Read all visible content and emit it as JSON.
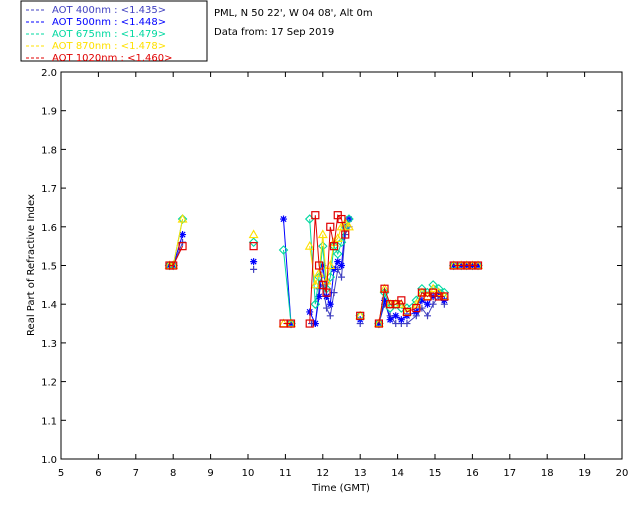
{
  "legend": [
    {
      "label": "AOT  400nm : <1.435>",
      "color": "#4040c0"
    },
    {
      "label": "AOT  500nm : <1.448>",
      "color": "#0000ff"
    },
    {
      "label": "AOT  675nm : <1.479>",
      "color": "#00d8a0"
    },
    {
      "label": "AOT  870nm : <1.478>",
      "color": "#ffe000"
    },
    {
      "label": "AOT 1020nm : <1.460>",
      "color": "#e00000"
    }
  ],
  "site_line": "PML, N 50 22', W 04 08', Alt 0m",
  "date_line": "Data from: 17 Sep 2019",
  "chart_data": {
    "type": "line",
    "xlabel": "Time (GMT)",
    "ylabel": "Real Part of Refractive Index",
    "xlim": [
      5,
      20
    ],
    "ylim": [
      1.0,
      2.0
    ],
    "x_ticks": [
      "5",
      "6",
      "7",
      "8",
      "9",
      "10",
      "11",
      "12",
      "13",
      "14",
      "15",
      "16",
      "17",
      "18",
      "19",
      "20"
    ],
    "y_ticks": [
      "1.0",
      "1.1",
      "1.2",
      "1.3",
      "1.4",
      "1.5",
      "1.6",
      "1.7",
      "1.8",
      "1.9",
      "2.0"
    ],
    "grid": false,
    "series": [
      {
        "name": "AOT 400nm",
        "color": "#4040c0",
        "marker": "plus",
        "points": [
          [
            [
              7.9,
              1.5
            ],
            [
              8.0,
              1.5
            ],
            [
              8.25,
              1.56
            ]
          ],
          [
            [
              10.15,
              1.49
            ]
          ],
          [
            [
              11.05,
              1.35
            ],
            [
              11.15,
              1.35
            ]
          ],
          [
            [
              11.7,
              1.35
            ],
            [
              11.8,
              1.35
            ],
            [
              11.9,
              1.44
            ],
            [
              12.0,
              1.45
            ],
            [
              12.1,
              1.39
            ],
            [
              12.2,
              1.37
            ],
            [
              12.3,
              1.43
            ],
            [
              12.4,
              1.49
            ],
            [
              12.5,
              1.47
            ],
            [
              12.6,
              1.58
            ],
            [
              12.7,
              1.6
            ]
          ],
          [
            [
              13.0,
              1.35
            ]
          ],
          [
            [
              13.5,
              1.35
            ],
            [
              13.65,
              1.4
            ],
            [
              13.8,
              1.37
            ],
            [
              13.95,
              1.35
            ],
            [
              14.1,
              1.35
            ],
            [
              14.25,
              1.35
            ],
            [
              14.5,
              1.37
            ],
            [
              14.65,
              1.39
            ],
            [
              14.8,
              1.37
            ],
            [
              14.95,
              1.4
            ],
            [
              15.1,
              1.42
            ],
            [
              15.25,
              1.4
            ]
          ],
          [
            [
              15.5,
              1.5
            ],
            [
              15.7,
              1.5
            ],
            [
              15.85,
              1.5
            ],
            [
              16.0,
              1.5
            ],
            [
              16.15,
              1.5
            ]
          ]
        ]
      },
      {
        "name": "AOT 500nm",
        "color": "#0000ff",
        "marker": "star",
        "points": [
          [
            [
              7.9,
              1.5
            ],
            [
              8.0,
              1.5
            ],
            [
              8.25,
              1.58
            ]
          ],
          [
            [
              10.15,
              1.51
            ]
          ],
          [
            [
              10.95,
              1.62
            ],
            [
              11.15,
              1.35
            ]
          ],
          [
            [
              11.65,
              1.38
            ],
            [
              11.8,
              1.35
            ],
            [
              11.9,
              1.42
            ],
            [
              12.0,
              1.5
            ],
            [
              12.1,
              1.42
            ],
            [
              12.2,
              1.4
            ],
            [
              12.3,
              1.49
            ],
            [
              12.4,
              1.51
            ],
            [
              12.5,
              1.5
            ],
            [
              12.6,
              1.6
            ],
            [
              12.7,
              1.62
            ]
          ],
          [
            [
              13.0,
              1.36
            ]
          ],
          [
            [
              13.5,
              1.35
            ],
            [
              13.65,
              1.41
            ],
            [
              13.8,
              1.36
            ],
            [
              13.95,
              1.37
            ],
            [
              14.1,
              1.36
            ],
            [
              14.25,
              1.37
            ],
            [
              14.5,
              1.38
            ],
            [
              14.65,
              1.41
            ],
            [
              14.8,
              1.4
            ],
            [
              14.95,
              1.42
            ],
            [
              15.1,
              1.43
            ],
            [
              15.25,
              1.41
            ]
          ],
          [
            [
              15.5,
              1.5
            ],
            [
              15.7,
              1.5
            ],
            [
              15.85,
              1.5
            ],
            [
              16.0,
              1.5
            ],
            [
              16.15,
              1.5
            ]
          ]
        ]
      },
      {
        "name": "AOT 675nm",
        "color": "#00d8a0",
        "marker": "diamond",
        "points": [
          [
            [
              7.9,
              1.5
            ],
            [
              8.0,
              1.5
            ],
            [
              8.25,
              1.62
            ]
          ],
          [
            [
              10.15,
              1.56
            ]
          ],
          [
            [
              10.95,
              1.54
            ],
            [
              11.15,
              1.35
            ]
          ],
          [
            [
              11.65,
              1.62
            ],
            [
              11.8,
              1.4
            ],
            [
              11.9,
              1.47
            ],
            [
              12.0,
              1.55
            ],
            [
              12.1,
              1.44
            ],
            [
              12.2,
              1.47
            ],
            [
              12.3,
              1.55
            ],
            [
              12.4,
              1.53
            ],
            [
              12.5,
              1.56
            ],
            [
              12.6,
              1.6
            ],
            [
              12.7,
              1.62
            ]
          ],
          [
            [
              13.0,
              1.37
            ]
          ],
          [
            [
              13.5,
              1.35
            ],
            [
              13.65,
              1.43
            ],
            [
              13.8,
              1.39
            ],
            [
              13.95,
              1.4
            ],
            [
              14.1,
              1.39
            ],
            [
              14.25,
              1.39
            ],
            [
              14.5,
              1.41
            ],
            [
              14.65,
              1.44
            ],
            [
              14.8,
              1.43
            ],
            [
              14.95,
              1.45
            ],
            [
              15.1,
              1.44
            ],
            [
              15.25,
              1.43
            ]
          ],
          [
            [
              15.5,
              1.5
            ],
            [
              15.7,
              1.5
            ],
            [
              15.85,
              1.5
            ],
            [
              16.0,
              1.5
            ],
            [
              16.15,
              1.5
            ]
          ]
        ]
      },
      {
        "name": "AOT 870nm",
        "color": "#ffe000",
        "marker": "triangle",
        "points": [
          [
            [
              7.9,
              1.5
            ],
            [
              8.0,
              1.5
            ],
            [
              8.25,
              1.62
            ]
          ],
          [
            [
              10.15,
              1.58
            ]
          ],
          [
            [
              10.95,
              1.35
            ],
            [
              11.15,
              1.35
            ]
          ],
          [
            [
              11.65,
              1.55
            ],
            [
              11.8,
              1.45
            ],
            [
              11.9,
              1.48
            ],
            [
              12.0,
              1.58
            ],
            [
              12.1,
              1.46
            ],
            [
              12.2,
              1.5
            ],
            [
              12.3,
              1.56
            ],
            [
              12.4,
              1.57
            ],
            [
              12.5,
              1.6
            ],
            [
              12.6,
              1.61
            ],
            [
              12.7,
              1.6
            ]
          ],
          [
            [
              13.0,
              1.37
            ]
          ],
          [
            [
              13.5,
              1.35
            ],
            [
              13.65,
              1.44
            ],
            [
              13.8,
              1.4
            ],
            [
              13.95,
              1.4
            ],
            [
              14.1,
              1.4
            ],
            [
              14.25,
              1.38
            ],
            [
              14.5,
              1.4
            ],
            [
              14.65,
              1.43
            ],
            [
              14.8,
              1.42
            ],
            [
              14.95,
              1.44
            ],
            [
              15.1,
              1.43
            ],
            [
              15.25,
              1.42
            ]
          ],
          [
            [
              15.5,
              1.5
            ],
            [
              15.7,
              1.5
            ],
            [
              15.85,
              1.5
            ],
            [
              16.0,
              1.5
            ],
            [
              16.15,
              1.5
            ]
          ]
        ]
      },
      {
        "name": "AOT 1020nm",
        "color": "#e00000",
        "marker": "square",
        "points": [
          [
            [
              7.9,
              1.5
            ],
            [
              8.0,
              1.5
            ],
            [
              8.25,
              1.55
            ]
          ],
          [
            [
              10.15,
              1.55
            ]
          ],
          [
            [
              10.95,
              1.35
            ],
            [
              11.15,
              1.35
            ]
          ],
          [
            [
              11.65,
              1.35
            ],
            [
              11.8,
              1.63
            ],
            [
              11.9,
              1.5
            ],
            [
              12.0,
              1.45
            ],
            [
              12.1,
              1.43
            ],
            [
              12.2,
              1.6
            ],
            [
              12.3,
              1.55
            ],
            [
              12.4,
              1.63
            ],
            [
              12.5,
              1.62
            ],
            [
              12.6,
              1.58
            ]
          ],
          [
            [
              13.0,
              1.37
            ]
          ],
          [
            [
              13.5,
              1.35
            ],
            [
              13.65,
              1.44
            ],
            [
              13.8,
              1.4
            ],
            [
              13.95,
              1.4
            ],
            [
              14.1,
              1.41
            ],
            [
              14.25,
              1.38
            ],
            [
              14.5,
              1.39
            ],
            [
              14.65,
              1.43
            ],
            [
              14.8,
              1.42
            ],
            [
              14.95,
              1.43
            ],
            [
              15.1,
              1.42
            ],
            [
              15.25,
              1.42
            ]
          ],
          [
            [
              15.5,
              1.5
            ],
            [
              15.7,
              1.5
            ],
            [
              15.85,
              1.5
            ],
            [
              16.0,
              1.5
            ],
            [
              16.15,
              1.5
            ]
          ]
        ]
      }
    ]
  }
}
